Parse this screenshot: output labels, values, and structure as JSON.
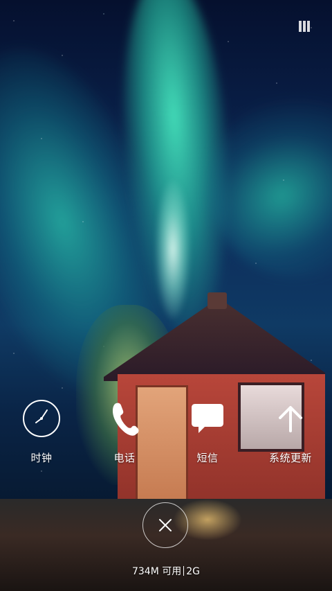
{
  "status_bar": {
    "icon": "battery-icon"
  },
  "shortcuts": [
    {
      "label": "时钟",
      "icon": "clock-icon"
    },
    {
      "label": "电话",
      "icon": "phone-icon"
    },
    {
      "label": "短信",
      "icon": "message-icon"
    },
    {
      "label": "系统更新",
      "icon": "arrow-up-icon"
    }
  ],
  "memory": {
    "available": "734M 可用",
    "network": "2G"
  },
  "close_button": {
    "icon": "close-icon"
  },
  "colors": {
    "icon_white": "#ffffff",
    "overlay_text": "#ffffff"
  }
}
